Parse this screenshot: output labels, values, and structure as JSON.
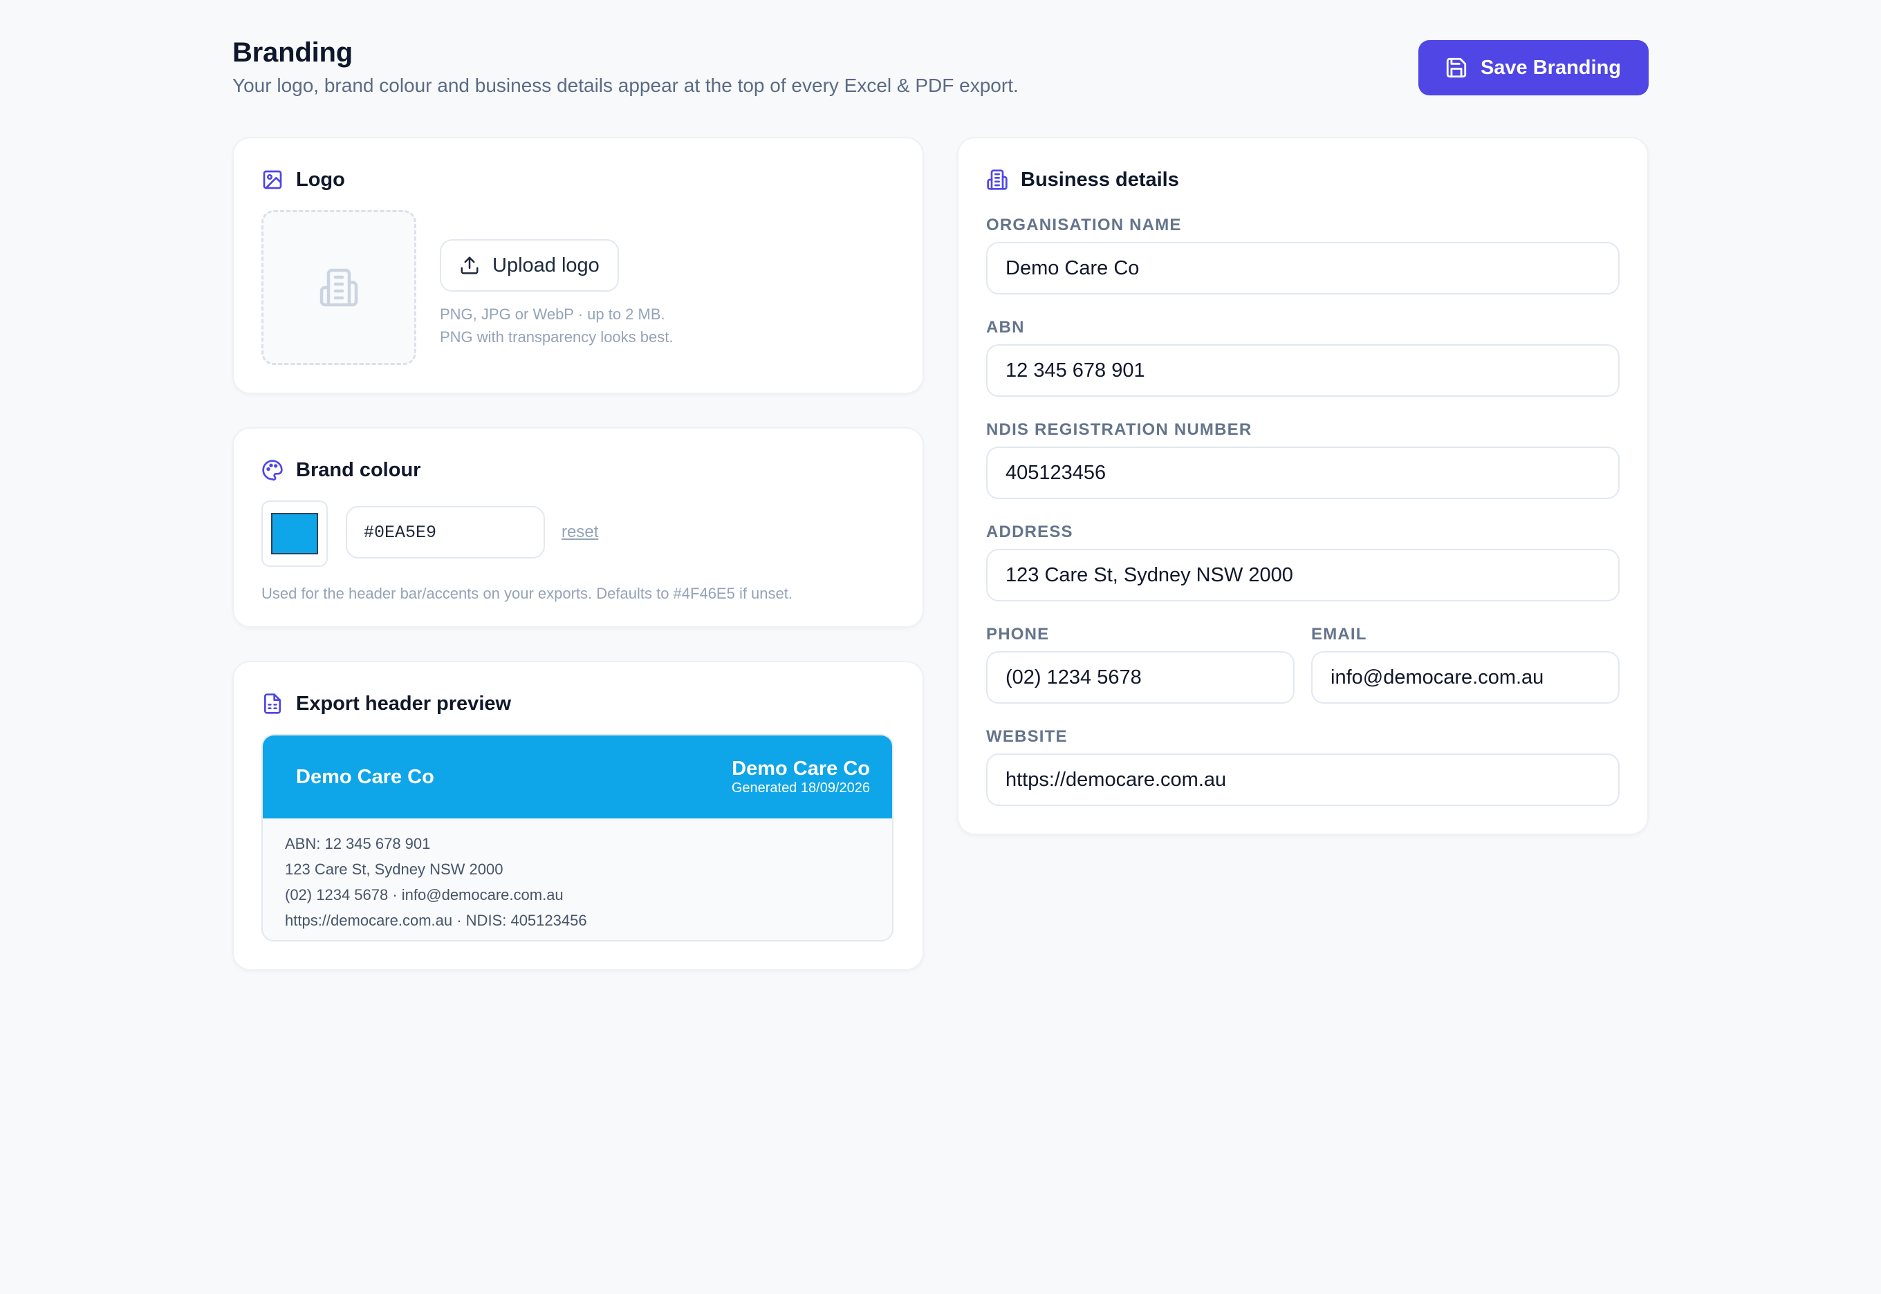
{
  "header": {
    "title": "Branding",
    "subtitle": "Your logo, brand colour and business details appear at the top of every Excel & PDF export.",
    "save_label": "Save Branding",
    "save_icon": "save-icon",
    "accent": "#4F46E5"
  },
  "logo": {
    "title": "Logo",
    "title_icon": "image-icon",
    "placeholder_icon": "building-icon",
    "upload_label": "Upload logo",
    "upload_icon": "upload-icon",
    "hint_line1": "PNG, JPG or WebP · up to 2 MB.",
    "hint_line2": "PNG with transparency looks best."
  },
  "brand": {
    "title": "Brand colour",
    "title_icon": "palette-icon",
    "value": "#0EA5E9",
    "reset_label": "reset",
    "hint": "Used for the header bar/accents on your exports. Defaults to #4F46E5 if unset."
  },
  "preview": {
    "title": "Export header preview",
    "title_icon": "document-icon",
    "name_left": "Demo Care Co",
    "name_right": "Demo Care Co",
    "generated": "Generated 18/09/2026",
    "line1": "ABN: 12 345 678 901",
    "line2": "123 Care St, Sydney NSW 2000",
    "line3": "(02) 1234 5678 · info@democare.com.au",
    "line4": "https://democare.com.au · NDIS: 405123456"
  },
  "business": {
    "title": "Business details",
    "title_icon": "building-icon",
    "org_label": "ORGANISATION NAME",
    "org_value": "Demo Care Co",
    "abn_label": "ABN",
    "abn_value": "12 345 678 901",
    "ndis_label": "NDIS REGISTRATION NUMBER",
    "ndis_value": "405123456",
    "address_label": "ADDRESS",
    "address_value": "123 Care St, Sydney NSW 2000",
    "phone_label": "PHONE",
    "phone_value": "(02) 1234 5678",
    "email_label": "EMAIL",
    "email_value": "info@democare.com.au",
    "website_label": "WEBSITE",
    "website_value": "https://democare.com.au"
  }
}
